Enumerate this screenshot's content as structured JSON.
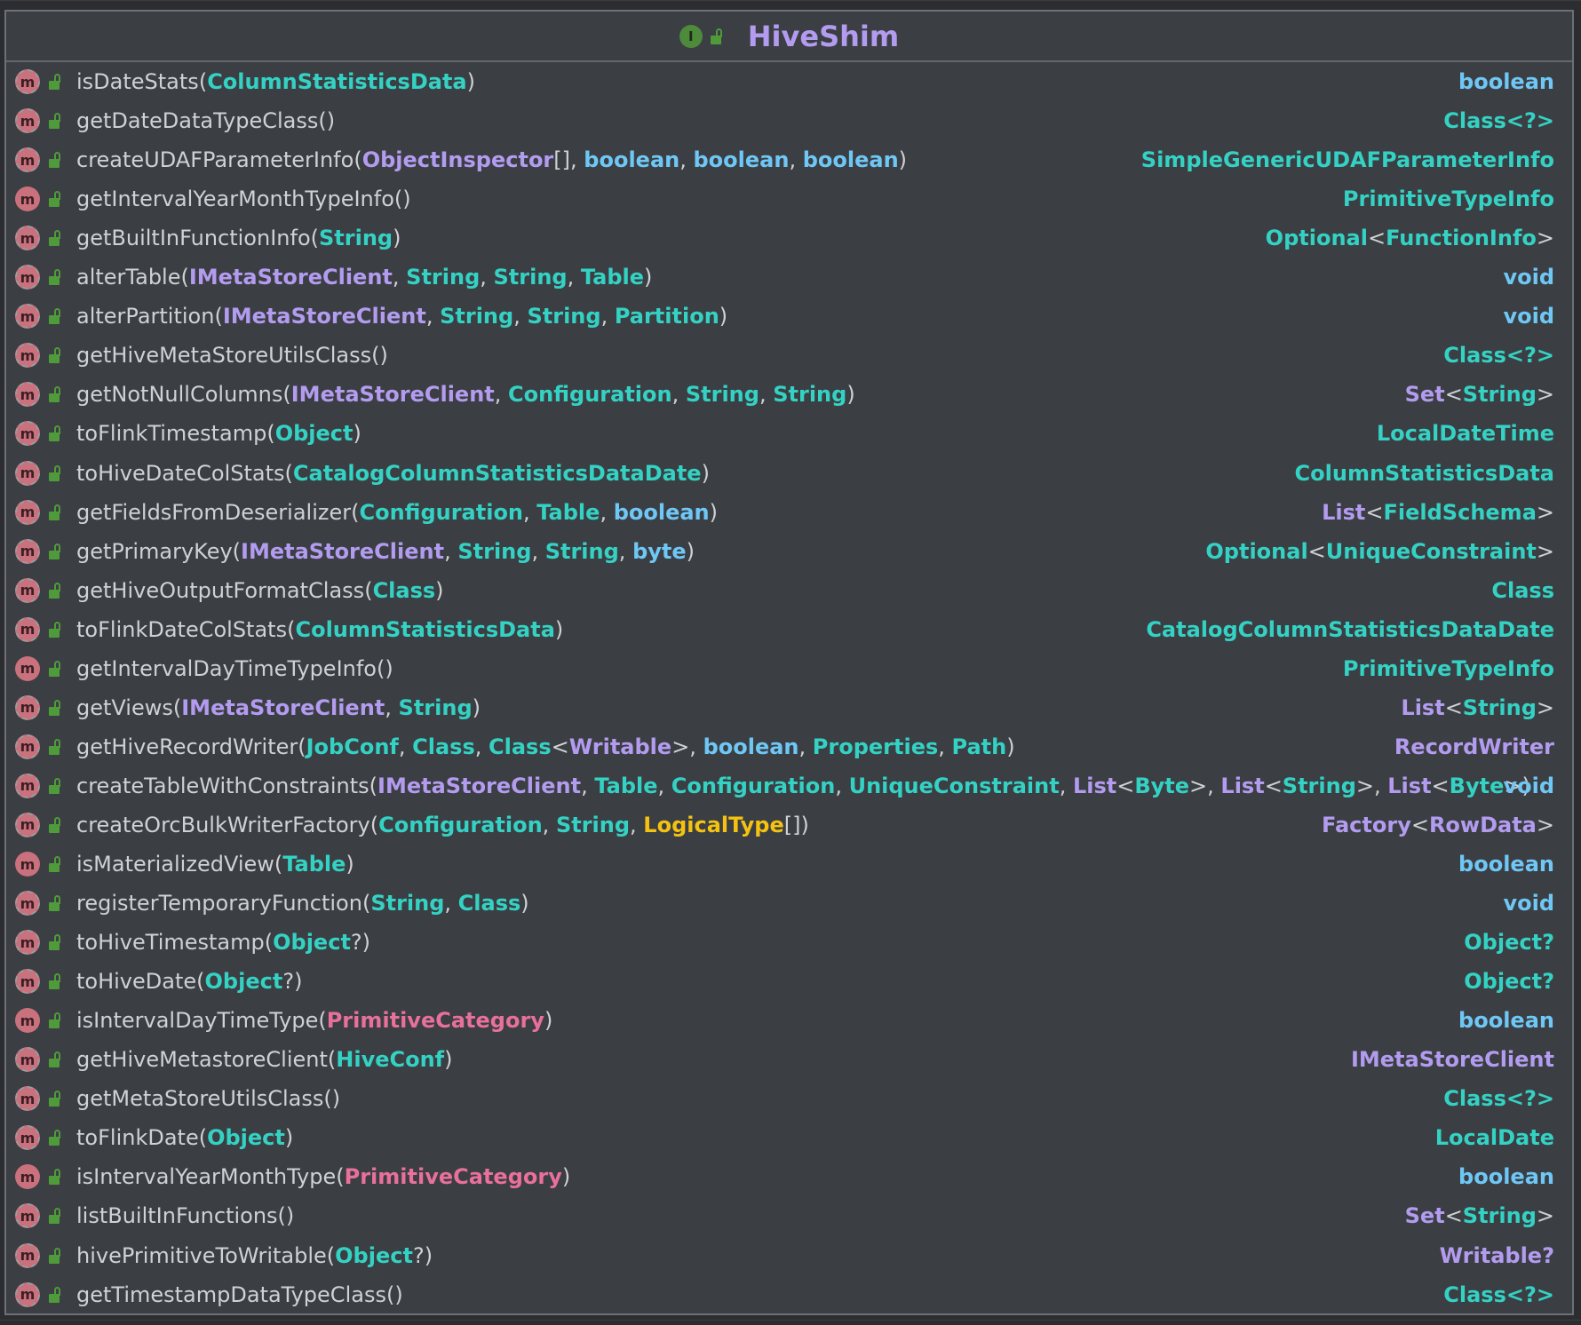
{
  "class_name": "HiveShim",
  "class_badge_letter": "I",
  "method_badge_letter": "m",
  "colors": {
    "background": "#2b2d30",
    "card": "#3b3e42",
    "class_title": "#b39cf0",
    "class_type": "#34d2c4",
    "keyword_type": "#6fc7f6",
    "interface_type": "#b39cf0",
    "enum_type": "#e8709a",
    "annotation_type": "#f4c211",
    "method_badge": "#c9717d",
    "visibility_lock": "#4f9a3a"
  },
  "methods": [
    {
      "name": "isDateStats",
      "abstract": true,
      "params": [
        [
          {
            "t": "ColumnStatisticsData",
            "k": "cls"
          }
        ]
      ],
      "ret": [
        {
          "t": "boolean",
          "k": "kw"
        }
      ]
    },
    {
      "name": "getDateDataTypeClass",
      "abstract": true,
      "params": [],
      "ret": [
        {
          "t": "Class",
          "k": "cls"
        },
        {
          "t": "<?>",
          "k": "cls"
        }
      ]
    },
    {
      "name": "createUDAFParameterInfo",
      "abstract": true,
      "params": [
        [
          {
            "t": "ObjectInspector",
            "k": "if"
          },
          {
            "t": "[]",
            "k": "p"
          }
        ],
        [
          {
            "t": "boolean",
            "k": "kw"
          }
        ],
        [
          {
            "t": "boolean",
            "k": "kw"
          }
        ],
        [
          {
            "t": "boolean",
            "k": "kw"
          }
        ]
      ],
      "ret": [
        {
          "t": "SimpleGenericUDAFParameterInfo",
          "k": "cls"
        }
      ]
    },
    {
      "name": "getIntervalYearMonthTypeInfo",
      "abstract": false,
      "params": [],
      "ret": [
        {
          "t": "PrimitiveTypeInfo",
          "k": "cls"
        }
      ]
    },
    {
      "name": "getBuiltInFunctionInfo",
      "abstract": true,
      "params": [
        [
          {
            "t": "String",
            "k": "cls"
          }
        ]
      ],
      "ret": [
        {
          "t": "Optional",
          "k": "cls"
        },
        {
          "t": "<",
          "k": "p"
        },
        {
          "t": "FunctionInfo",
          "k": "cls"
        },
        {
          "t": ">",
          "k": "p"
        }
      ]
    },
    {
      "name": "alterTable",
      "abstract": true,
      "params": [
        [
          {
            "t": "IMetaStoreClient",
            "k": "if"
          }
        ],
        [
          {
            "t": "String",
            "k": "cls"
          }
        ],
        [
          {
            "t": "String",
            "k": "cls"
          }
        ],
        [
          {
            "t": "Table",
            "k": "cls"
          }
        ]
      ],
      "ret": [
        {
          "t": "void",
          "k": "kw"
        }
      ]
    },
    {
      "name": "alterPartition",
      "abstract": true,
      "params": [
        [
          {
            "t": "IMetaStoreClient",
            "k": "if"
          }
        ],
        [
          {
            "t": "String",
            "k": "cls"
          }
        ],
        [
          {
            "t": "String",
            "k": "cls"
          }
        ],
        [
          {
            "t": "Partition",
            "k": "cls"
          }
        ]
      ],
      "ret": [
        {
          "t": "void",
          "k": "kw"
        }
      ]
    },
    {
      "name": "getHiveMetaStoreUtilsClass",
      "abstract": true,
      "params": [],
      "ret": [
        {
          "t": "Class",
          "k": "cls"
        },
        {
          "t": "<?>",
          "k": "cls"
        }
      ]
    },
    {
      "name": "getNotNullColumns",
      "abstract": true,
      "params": [
        [
          {
            "t": "IMetaStoreClient",
            "k": "if"
          }
        ],
        [
          {
            "t": "Configuration",
            "k": "cls"
          }
        ],
        [
          {
            "t": "String",
            "k": "cls"
          }
        ],
        [
          {
            "t": "String",
            "k": "cls"
          }
        ]
      ],
      "ret": [
        {
          "t": "Set",
          "k": "if"
        },
        {
          "t": "<",
          "k": "p"
        },
        {
          "t": "String",
          "k": "cls"
        },
        {
          "t": ">",
          "k": "p"
        }
      ]
    },
    {
      "name": "toFlinkTimestamp",
      "abstract": true,
      "params": [
        [
          {
            "t": "Object",
            "k": "cls"
          }
        ]
      ],
      "ret": [
        {
          "t": "LocalDateTime",
          "k": "cls"
        }
      ]
    },
    {
      "name": "toHiveDateColStats",
      "abstract": true,
      "params": [
        [
          {
            "t": "CatalogColumnStatisticsDataDate",
            "k": "cls"
          }
        ]
      ],
      "ret": [
        {
          "t": "ColumnStatisticsData",
          "k": "cls"
        }
      ]
    },
    {
      "name": "getFieldsFromDeserializer",
      "abstract": true,
      "params": [
        [
          {
            "t": "Configuration",
            "k": "cls"
          }
        ],
        [
          {
            "t": "Table",
            "k": "cls"
          }
        ],
        [
          {
            "t": "boolean",
            "k": "kw"
          }
        ]
      ],
      "ret": [
        {
          "t": "List",
          "k": "if"
        },
        {
          "t": "<",
          "k": "p"
        },
        {
          "t": "FieldSchema",
          "k": "cls"
        },
        {
          "t": ">",
          "k": "p"
        }
      ]
    },
    {
      "name": "getPrimaryKey",
      "abstract": true,
      "params": [
        [
          {
            "t": "IMetaStoreClient",
            "k": "if"
          }
        ],
        [
          {
            "t": "String",
            "k": "cls"
          }
        ],
        [
          {
            "t": "String",
            "k": "cls"
          }
        ],
        [
          {
            "t": "byte",
            "k": "kw"
          }
        ]
      ],
      "ret": [
        {
          "t": "Optional",
          "k": "cls"
        },
        {
          "t": "<",
          "k": "p"
        },
        {
          "t": "UniqueConstraint",
          "k": "cls"
        },
        {
          "t": ">",
          "k": "p"
        }
      ]
    },
    {
      "name": "getHiveOutputFormatClass",
      "abstract": true,
      "params": [
        [
          {
            "t": "Class",
            "k": "cls"
          }
        ]
      ],
      "ret": [
        {
          "t": "Class",
          "k": "cls"
        }
      ]
    },
    {
      "name": "toFlinkDateColStats",
      "abstract": true,
      "params": [
        [
          {
            "t": "ColumnStatisticsData",
            "k": "cls"
          }
        ]
      ],
      "ret": [
        {
          "t": "CatalogColumnStatisticsDataDate",
          "k": "cls"
        }
      ]
    },
    {
      "name": "getIntervalDayTimeTypeInfo",
      "abstract": false,
      "params": [],
      "ret": [
        {
          "t": "PrimitiveTypeInfo",
          "k": "cls"
        }
      ]
    },
    {
      "name": "getViews",
      "abstract": true,
      "params": [
        [
          {
            "t": "IMetaStoreClient",
            "k": "if"
          }
        ],
        [
          {
            "t": "String",
            "k": "cls"
          }
        ]
      ],
      "ret": [
        {
          "t": "List",
          "k": "if"
        },
        {
          "t": "<",
          "k": "p"
        },
        {
          "t": "String",
          "k": "cls"
        },
        {
          "t": ">",
          "k": "p"
        }
      ]
    },
    {
      "name": "getHiveRecordWriter",
      "abstract": true,
      "params": [
        [
          {
            "t": "JobConf",
            "k": "cls"
          }
        ],
        [
          {
            "t": "Class",
            "k": "cls"
          }
        ],
        [
          {
            "t": "Class",
            "k": "cls"
          },
          {
            "t": "<",
            "k": "p"
          },
          {
            "t": "Writable",
            "k": "if"
          },
          {
            "t": ">",
            "k": "p"
          }
        ],
        [
          {
            "t": "boolean",
            "k": "kw"
          }
        ],
        [
          {
            "t": "Properties",
            "k": "cls"
          }
        ],
        [
          {
            "t": "Path",
            "k": "cls"
          }
        ]
      ],
      "ret": [
        {
          "t": "RecordWriter",
          "k": "if"
        }
      ]
    },
    {
      "name": "createTableWithConstraints",
      "abstract": true,
      "params": [
        [
          {
            "t": "IMetaStoreClient",
            "k": "if"
          }
        ],
        [
          {
            "t": "Table",
            "k": "cls"
          }
        ],
        [
          {
            "t": "Configuration",
            "k": "cls"
          }
        ],
        [
          {
            "t": "UniqueConstraint",
            "k": "cls"
          }
        ],
        [
          {
            "t": "List",
            "k": "if"
          },
          {
            "t": "<",
            "k": "p"
          },
          {
            "t": "Byte",
            "k": "cls"
          },
          {
            "t": ">",
            "k": "p"
          }
        ],
        [
          {
            "t": "List",
            "k": "if"
          },
          {
            "t": "<",
            "k": "p"
          },
          {
            "t": "String",
            "k": "cls"
          },
          {
            "t": ">",
            "k": "p"
          }
        ],
        [
          {
            "t": "List",
            "k": "if"
          },
          {
            "t": "<",
            "k": "p"
          },
          {
            "t": "Byte",
            "k": "cls"
          },
          {
            "t": ">",
            "k": "p"
          }
        ]
      ],
      "ret": [
        {
          "t": "void",
          "k": "kw"
        }
      ]
    },
    {
      "name": "createOrcBulkWriterFactory",
      "abstract": true,
      "params": [
        [
          {
            "t": "Configuration",
            "k": "cls"
          }
        ],
        [
          {
            "t": "String",
            "k": "cls"
          }
        ],
        [
          {
            "t": "LogicalType",
            "k": "ann"
          },
          {
            "t": "[]",
            "k": "p"
          }
        ]
      ],
      "ret": [
        {
          "t": "Factory",
          "k": "if"
        },
        {
          "t": "<",
          "k": "p"
        },
        {
          "t": "RowData",
          "k": "if"
        },
        {
          "t": ">",
          "k": "p"
        }
      ]
    },
    {
      "name": "isMaterializedView",
      "abstract": false,
      "params": [
        [
          {
            "t": "Table",
            "k": "cls"
          }
        ]
      ],
      "ret": [
        {
          "t": "boolean",
          "k": "kw"
        }
      ]
    },
    {
      "name": "registerTemporaryFunction",
      "abstract": true,
      "params": [
        [
          {
            "t": "String",
            "k": "cls"
          }
        ],
        [
          {
            "t": "Class",
            "k": "cls"
          }
        ]
      ],
      "ret": [
        {
          "t": "void",
          "k": "kw"
        }
      ]
    },
    {
      "name": "toHiveTimestamp",
      "abstract": true,
      "params": [
        [
          {
            "t": "Object",
            "k": "cls"
          },
          {
            "t": "?",
            "k": "p"
          }
        ]
      ],
      "ret": [
        {
          "t": "Object",
          "k": "cls"
        },
        {
          "t": "?",
          "k": "cls"
        }
      ]
    },
    {
      "name": "toHiveDate",
      "abstract": true,
      "params": [
        [
          {
            "t": "Object",
            "k": "cls"
          },
          {
            "t": "?",
            "k": "p"
          }
        ]
      ],
      "ret": [
        {
          "t": "Object",
          "k": "cls"
        },
        {
          "t": "?",
          "k": "cls"
        }
      ]
    },
    {
      "name": "isIntervalDayTimeType",
      "abstract": false,
      "params": [
        [
          {
            "t": "PrimitiveCategory",
            "k": "enum"
          }
        ]
      ],
      "ret": [
        {
          "t": "boolean",
          "k": "kw"
        }
      ]
    },
    {
      "name": "getHiveMetastoreClient",
      "abstract": true,
      "params": [
        [
          {
            "t": "HiveConf",
            "k": "cls"
          }
        ]
      ],
      "ret": [
        {
          "t": "IMetaStoreClient",
          "k": "if"
        }
      ]
    },
    {
      "name": "getMetaStoreUtilsClass",
      "abstract": true,
      "params": [],
      "ret": [
        {
          "t": "Class",
          "k": "cls"
        },
        {
          "t": "<?>",
          "k": "cls"
        }
      ]
    },
    {
      "name": "toFlinkDate",
      "abstract": true,
      "params": [
        [
          {
            "t": "Object",
            "k": "cls"
          }
        ]
      ],
      "ret": [
        {
          "t": "LocalDate",
          "k": "cls"
        }
      ]
    },
    {
      "name": "isIntervalYearMonthType",
      "abstract": false,
      "params": [
        [
          {
            "t": "PrimitiveCategory",
            "k": "enum"
          }
        ]
      ],
      "ret": [
        {
          "t": "boolean",
          "k": "kw"
        }
      ]
    },
    {
      "name": "listBuiltInFunctions",
      "abstract": true,
      "params": [],
      "ret": [
        {
          "t": "Set",
          "k": "if"
        },
        {
          "t": "<",
          "k": "p"
        },
        {
          "t": "String",
          "k": "cls"
        },
        {
          "t": ">",
          "k": "p"
        }
      ]
    },
    {
      "name": "hivePrimitiveToWritable",
      "abstract": true,
      "params": [
        [
          {
            "t": "Object",
            "k": "cls"
          },
          {
            "t": "?",
            "k": "p"
          }
        ]
      ],
      "ret": [
        {
          "t": "Writable",
          "k": "if"
        },
        {
          "t": "?",
          "k": "if"
        }
      ]
    },
    {
      "name": "getTimestampDataTypeClass",
      "abstract": true,
      "params": [],
      "ret": [
        {
          "t": "Class",
          "k": "cls"
        },
        {
          "t": "<?>",
          "k": "cls"
        }
      ]
    }
  ]
}
